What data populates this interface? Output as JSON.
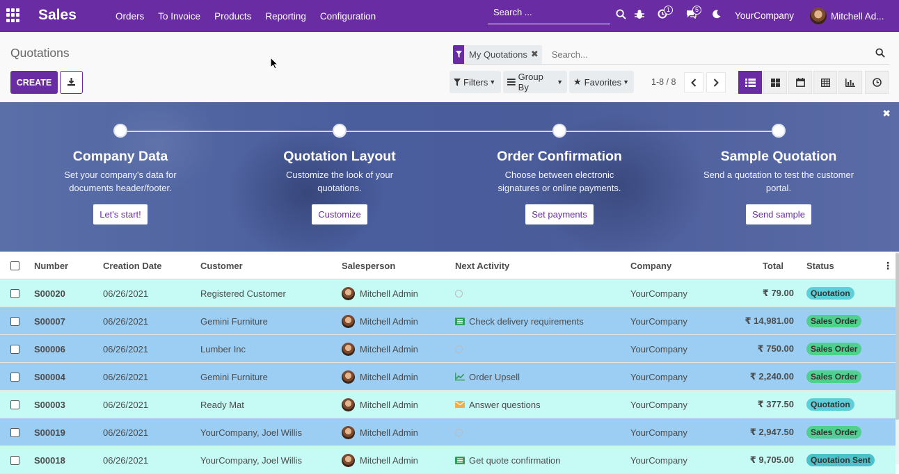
{
  "navbar": {
    "brand": "Sales",
    "menu": [
      "Orders",
      "To Invoice",
      "Products",
      "Reporting",
      "Configuration"
    ],
    "search_placeholder": "Search ...",
    "activity_count": "1",
    "messages_count": "5",
    "company": "YourCompany",
    "user": "Mitchell Ad..."
  },
  "control": {
    "title": "Quotations",
    "create_label": "CREATE",
    "facet_label": "My Quotations",
    "search_placeholder": "Search...",
    "filters_label": "Filters",
    "groupby_label": "Group By",
    "favorites_label": "Favorites",
    "pager": "1-8 / 8"
  },
  "banner": {
    "steps": [
      {
        "title": "Company Data",
        "desc": "Set your company's data for documents header/footer.",
        "button": "Let's start!"
      },
      {
        "title": "Quotation Layout",
        "desc": "Customize the look of your quotations.",
        "button": "Customize"
      },
      {
        "title": "Order Confirmation",
        "desc": "Choose between electronic signatures or online payments.",
        "button": "Set payments"
      },
      {
        "title": "Sample Quotation",
        "desc": "Send a quotation to test the customer portal.",
        "button": "Send sample"
      }
    ]
  },
  "table": {
    "headers": {
      "number": "Number",
      "date": "Creation Date",
      "customer": "Customer",
      "salesperson": "Salesperson",
      "activity": "Next Activity",
      "company": "Company",
      "total": "Total",
      "status": "Status"
    },
    "rows": [
      {
        "number": "S00020",
        "date": "06/26/2021",
        "customer": "Registered Customer",
        "salesperson": "Mitchell Admin",
        "activity": "",
        "activity_icon": "clock-icon",
        "company": "YourCompany",
        "total": "₹ 79.00",
        "status": "Quotation"
      },
      {
        "number": "S00007",
        "date": "06/26/2021",
        "customer": "Gemini Furniture",
        "salesperson": "Mitchell Admin",
        "activity": "Check delivery requirements",
        "activity_icon": "todo-icon",
        "company": "YourCompany",
        "total": "₹ 14,981.00",
        "status": "Sales Order"
      },
      {
        "number": "S00006",
        "date": "06/26/2021",
        "customer": "Lumber Inc",
        "salesperson": "Mitchell Admin",
        "activity": "",
        "activity_icon": "clock-icon",
        "company": "YourCompany",
        "total": "₹ 750.00",
        "status": "Sales Order"
      },
      {
        "number": "S00004",
        "date": "06/26/2021",
        "customer": "Gemini Furniture",
        "salesperson": "Mitchell Admin",
        "activity": "Order Upsell",
        "activity_icon": "upsell-chart-icon",
        "company": "YourCompany",
        "total": "₹ 2,240.00",
        "status": "Sales Order"
      },
      {
        "number": "S00003",
        "date": "06/26/2021",
        "customer": "Ready Mat",
        "salesperson": "Mitchell Admin",
        "activity": "Answer questions",
        "activity_icon": "email-icon",
        "company": "YourCompany",
        "total": "₹ 377.50",
        "status": "Quotation"
      },
      {
        "number": "S00019",
        "date": "06/26/2021",
        "customer": "YourCompany, Joel Willis",
        "salesperson": "Mitchell Admin",
        "activity": "",
        "activity_icon": "clock-icon",
        "company": "YourCompany",
        "total": "₹ 2,947.50",
        "status": "Sales Order"
      },
      {
        "number": "S00018",
        "date": "06/26/2021",
        "customer": "YourCompany, Joel Willis",
        "salesperson": "Mitchell Admin",
        "activity": "Get quote confirmation",
        "activity_icon": "todo-icon",
        "company": "YourCompany",
        "total": "₹ 9,705.00",
        "status": "Quotation Sent"
      }
    ]
  },
  "colors": {
    "brand": "#6a2ca3",
    "row_quotation": "#c6fbf5",
    "row_order": "#9ccef3"
  }
}
